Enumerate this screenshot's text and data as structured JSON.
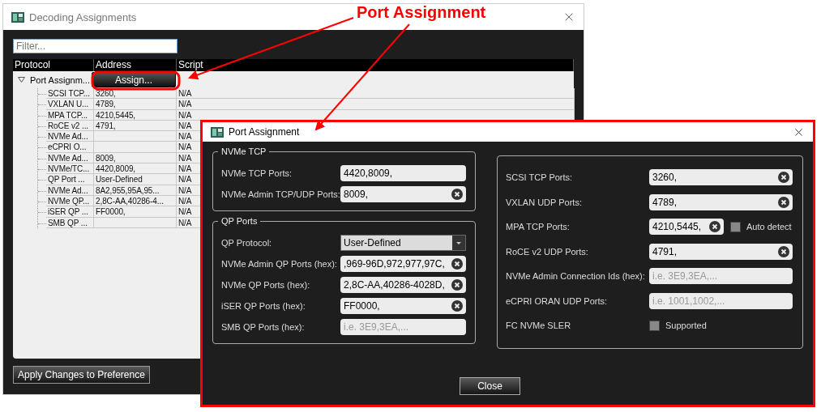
{
  "main_window": {
    "title": "Decoding Assignments",
    "filter": {
      "placeholder": "Filter..."
    },
    "table": {
      "columns": [
        "Protocol",
        "Address",
        "Script"
      ],
      "root": {
        "protocol": "Port Assignm...",
        "expanded": true,
        "button": "Assign...",
        "children": [
          {
            "protocol": "SCSI TCP...",
            "address": "3260,",
            "script": "N/A"
          },
          {
            "protocol": "VXLAN U...",
            "address": "4789,",
            "script": "N/A"
          },
          {
            "protocol": "MPA TCP...",
            "address": "4210,5445,",
            "script": "N/A"
          },
          {
            "protocol": "RoCE v2 ...",
            "address": "4791,",
            "script": "N/A"
          },
          {
            "protocol": "NVMe Ad...",
            "script": "N/A"
          },
          {
            "protocol": "eCPRI O...",
            "script": "N/A"
          },
          {
            "protocol": "NVMe Ad...",
            "address": "8009,",
            "script": "N/A"
          },
          {
            "protocol": "NVMe/TC...",
            "address": "4420,8009,",
            "script": "N/A"
          },
          {
            "protocol": "QP Port ...",
            "address": "User-Defined",
            "script": "N/A"
          },
          {
            "protocol": "NVMe Ad...",
            "address": "8A2,955,95A,95...",
            "script": "N/A"
          },
          {
            "protocol": "NVMe QP...",
            "address": "2,8C-AA,40286-4...",
            "script": "N/A"
          },
          {
            "protocol": "iSER QP ...",
            "address": "FF0000,",
            "script": "N/A"
          },
          {
            "protocol": "SMB QP ...",
            "script": "N/A"
          }
        ]
      }
    },
    "apply_button": "Apply Changes to Preference"
  },
  "callout": {
    "text": "Port Assignment"
  },
  "dialog": {
    "title": "Port Assignment",
    "left_groups": [
      {
        "title": "NVMe TCP",
        "rows": [
          {
            "kind": "text",
            "label": "NVMe TCP Ports:",
            "value": "4420,8009,",
            "clear_button": false
          },
          {
            "kind": "text",
            "label": "NVMe Admin TCP/UDP Ports:",
            "value": "8009,",
            "clear_button": true
          }
        ]
      },
      {
        "title": "QP Ports",
        "rows": [
          {
            "kind": "dropdown",
            "label": "QP Protocol:",
            "value": "User-Defined"
          },
          {
            "kind": "text",
            "label": "NVMe Admin QP Ports (hex):",
            "value": ",969-96D,972,977,97C,",
            "clear_button": true
          },
          {
            "kind": "text",
            "label": "NVMe QP Ports (hex):",
            "value": "2,8C-AA,40286-4028D,",
            "clear_button": true
          },
          {
            "kind": "text",
            "label": "iSER QP Ports (hex):",
            "value": "FF0000,",
            "clear_button": true
          },
          {
            "kind": "text",
            "label": "SMB QP Ports (hex):",
            "placeholder": "i.e. 3E9,3EA,...",
            "clear_button": false
          }
        ]
      }
    ],
    "right_rows": [
      {
        "kind": "text",
        "label": "SCSI TCP Ports:",
        "value": "3260,",
        "clear_button": true
      },
      {
        "kind": "text",
        "label": "VXLAN UDP Ports:",
        "value": "4789,",
        "clear_button": true
      },
      {
        "kind": "text",
        "label": "MPA TCP Ports:",
        "value": "4210,5445,",
        "clear_button": true,
        "auto_detect": {
          "label": "Auto detect",
          "checked": false
        }
      },
      {
        "kind": "text",
        "label": "RoCE v2 UDP Ports:",
        "value": "4791,",
        "clear_button": true
      },
      {
        "kind": "text",
        "label": "NVMe Admin Connection Ids (hex):",
        "placeholder": "i.e. 3E9,3EA,...",
        "clear_button": false
      },
      {
        "kind": "text",
        "label": "eCPRI ORAN UDP Ports:",
        "placeholder": "i.e. 1001,1002,...",
        "clear_button": false
      },
      {
        "kind": "checkbox",
        "label": "FC NVMe SLER",
        "checkbox_label": "Supported",
        "checked": false
      }
    ],
    "close_button": "Close"
  }
}
